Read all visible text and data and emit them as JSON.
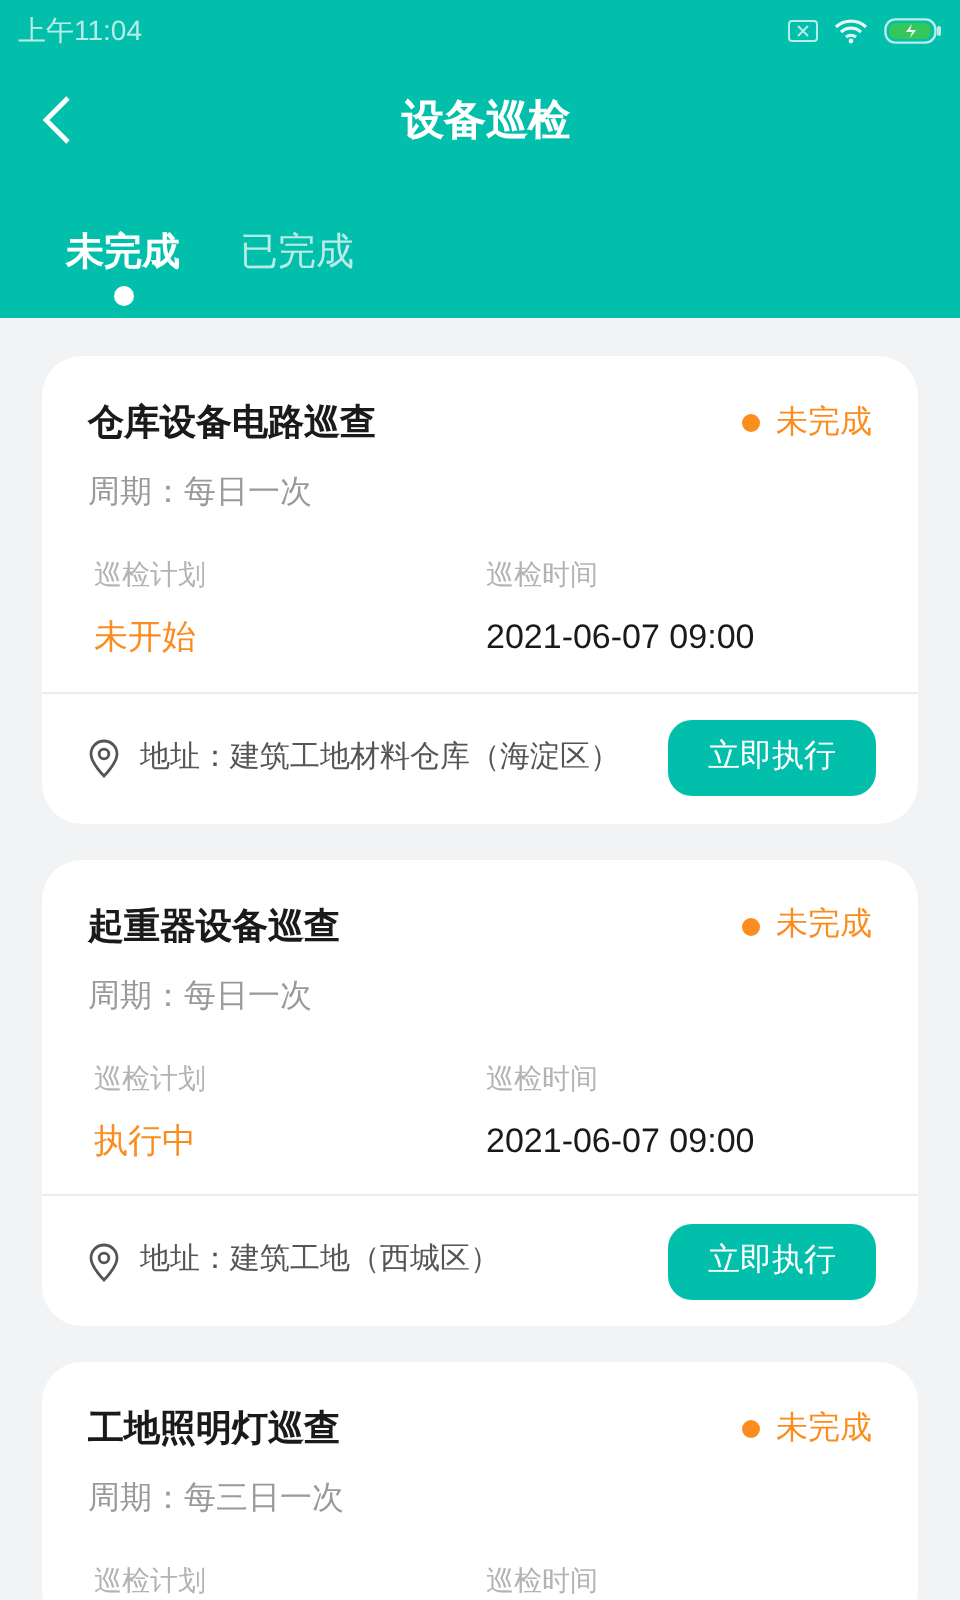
{
  "status_bar": {
    "time": "上午11:04"
  },
  "header": {
    "title": "设备巡检"
  },
  "tabs": [
    {
      "label": "未完成",
      "selected": true
    },
    {
      "label": "已完成",
      "selected": false
    }
  ],
  "tasks": [
    {
      "title": "仓库设备电路巡查",
      "status": "未完成",
      "period": "周期：每日一次",
      "plan_label": "巡检计划",
      "plan_value": "未开始",
      "time_label": "巡检时间",
      "time_value": "2021-06-07 09:00",
      "address": "地址：建筑工地材料仓库（海淀区）",
      "action": "立即执行"
    },
    {
      "title": "起重器设备巡查",
      "status": "未完成",
      "period": "周期：每日一次",
      "plan_label": "巡检计划",
      "plan_value": "执行中",
      "time_label": "巡检时间",
      "time_value": "2021-06-07 09:00",
      "address": "地址：建筑工地（西城区）",
      "action": "立即执行"
    },
    {
      "title": "工地照明灯巡查",
      "status": "未完成",
      "period": "周期：每三日一次",
      "plan_label": "巡检计划",
      "time_label": "巡检时间"
    }
  ]
}
